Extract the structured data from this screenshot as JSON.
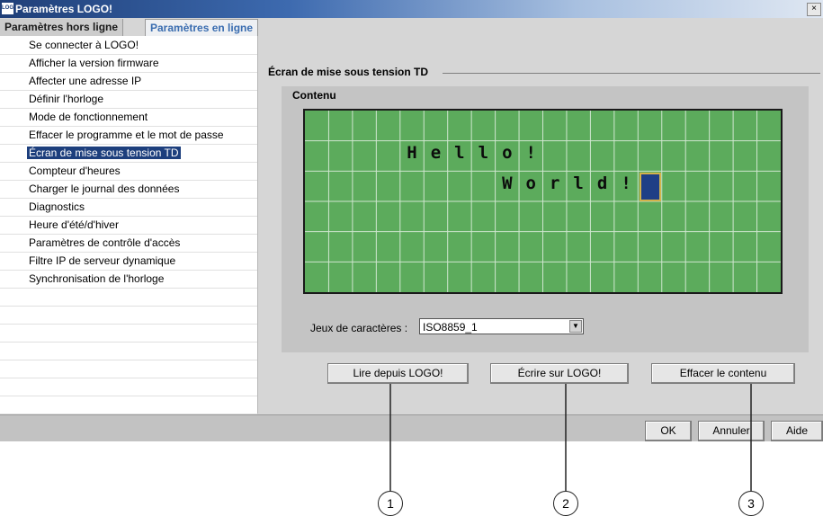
{
  "window": {
    "title": "Paramètres LOGO!",
    "close_glyph": "×",
    "logo_text": "LOGO"
  },
  "tabs": [
    {
      "label": "Paramètres hors ligne"
    },
    {
      "label": "Paramètres en ligne"
    }
  ],
  "sidebar": {
    "items": [
      {
        "label": "Se connecter à LOGO!"
      },
      {
        "label": "Afficher la version firmware"
      },
      {
        "label": "Affecter une adresse IP"
      },
      {
        "label": "Définir l'horloge"
      },
      {
        "label": "Mode de fonctionnement"
      },
      {
        "label": "Effacer le programme et le mot de passe"
      },
      {
        "label": "Écran de mise sous tension TD",
        "selected": true
      },
      {
        "label": "Compteur d'heures"
      },
      {
        "label": "Charger le journal des données"
      },
      {
        "label": "Diagnostics"
      },
      {
        "label": "Heure d'été/d'hiver"
      },
      {
        "label": "Paramètres de contrôle d'accès"
      },
      {
        "label": "Filtre IP de serveur dynamique"
      },
      {
        "label": "Synchronisation de l'horloge"
      }
    ]
  },
  "main": {
    "section_title": "Écran de mise sous tension TD",
    "group_label": "Contenu",
    "lcd": {
      "rows": 6,
      "cols": 20,
      "lines": [
        {
          "row": 2,
          "col": 4,
          "text": "Hello!"
        },
        {
          "row": 3,
          "col": 8,
          "text": "World!"
        }
      ],
      "cursor": {
        "row": 3,
        "col": 14
      },
      "colors": {
        "background": "#5cab5c",
        "grid": "#cfe6cf",
        "cursor": "#1f3f86",
        "cursor_border": "#d4b24a"
      }
    },
    "charset_label": "Jeux de caractères :",
    "charset_value": "ISO8859_1",
    "buttons": {
      "read": "Lire depuis LOGO!",
      "write": "Écrire sur LOGO!",
      "clear": "Effacer le contenu"
    }
  },
  "footer": {
    "ok": "OK",
    "cancel": "Annuler",
    "help": "Aide"
  },
  "callouts": [
    "1",
    "2",
    "3"
  ]
}
